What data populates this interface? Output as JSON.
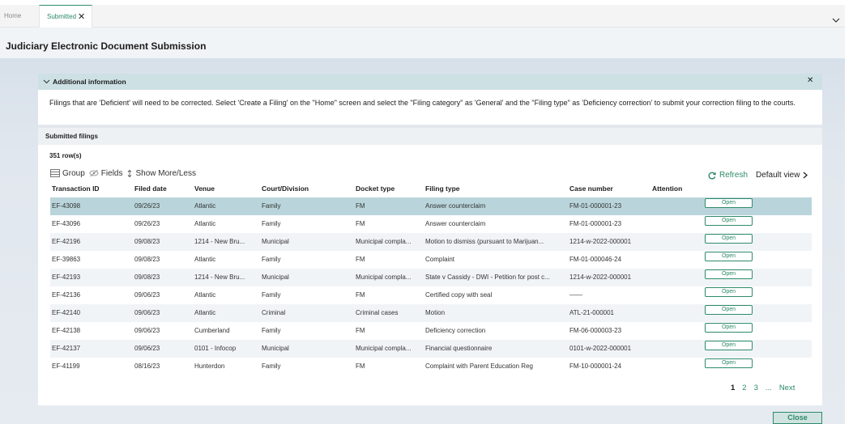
{
  "tabs": {
    "home": "Home",
    "submitted": "Submitted",
    "submitted_close": "✕"
  },
  "page_title": "Judiciary Electronic Document Submission",
  "info": {
    "title": "Additional information",
    "close": "✕",
    "text": "Filings that are 'Deficient' will need to be corrected. Select 'Create a Filing' on the \"Home\" screen and select the \"Filing category\" as 'General' and the \"Filing type\" as 'Deficiency correction' to submit your correction filing to the courts."
  },
  "submitted": {
    "title": "Submitted filings",
    "row_count": "351 row(s)",
    "toolbar": {
      "group": "Group",
      "fields": "Fields",
      "show_more": "Show More/Less"
    },
    "refresh": "Refresh",
    "default_view": "Default view",
    "columns": [
      "Transaction ID",
      "Filed date",
      "Venue",
      "Court/Division",
      "Docket type",
      "Filing type",
      "Case number",
      "Attention"
    ],
    "open_label": "Open",
    "rows": [
      {
        "id": "EF-43098",
        "date": "09/26/23",
        "venue": "Atlantic",
        "court": "Family",
        "docket": "FM",
        "filing": "Answer counterclaim",
        "case": "FM-01-000001-23",
        "attention": ""
      },
      {
        "id": "EF-43096",
        "date": "09/26/23",
        "venue": "Atlantic",
        "court": "Family",
        "docket": "FM",
        "filing": "Answer counterclaim",
        "case": "FM-01-000001-23",
        "attention": ""
      },
      {
        "id": "EF-42196",
        "date": "09/08/23",
        "venue": "1214 - New Bru...",
        "court": "Municipal",
        "docket": "Municipal compla...",
        "filing": "Motion to dismiss (pursuant to Marijuan...",
        "case": "1214-w-2022-000001",
        "attention": ""
      },
      {
        "id": "EF-39863",
        "date": "09/08/23",
        "venue": "Atlantic",
        "court": "Family",
        "docket": "FM",
        "filing": "Complaint",
        "case": "FM-01-000046-24",
        "attention": ""
      },
      {
        "id": "EF-42193",
        "date": "09/08/23",
        "venue": "1214 - New Bru...",
        "court": "Municipal",
        "docket": "Municipal compla...",
        "filing": "State v Cassidy - DWI - Petition for post c...",
        "case": "1214-w-2022-000001",
        "attention": ""
      },
      {
        "id": "EF-42136",
        "date": "09/06/23",
        "venue": "Atlantic",
        "court": "Family",
        "docket": "FM",
        "filing": "Certified copy with seal",
        "case": "——",
        "attention": ""
      },
      {
        "id": "EF-42140",
        "date": "09/06/23",
        "venue": "Atlantic",
        "court": "Criminal",
        "docket": "Criminal cases",
        "filing": "Motion",
        "case": "ATL-21-000001",
        "attention": ""
      },
      {
        "id": "EF-42138",
        "date": "09/06/23",
        "venue": "Cumberland",
        "court": "Family",
        "docket": "FM",
        "filing": "Deficiency correction",
        "case": "FM-06-000003-23",
        "attention": ""
      },
      {
        "id": "EF-42137",
        "date": "09/06/23",
        "venue": "0101 - Infocop",
        "court": "Municipal",
        "docket": "Municipal compla...",
        "filing": "Financial questionnaire",
        "case": "0101-w-2022-000001",
        "attention": ""
      },
      {
        "id": "EF-41199",
        "date": "08/16/23",
        "venue": "Hunterdon",
        "court": "Family",
        "docket": "FM",
        "filing": "Complaint with Parent Education Reg",
        "case": "FM-10-000001-24",
        "attention": ""
      }
    ],
    "pagination": {
      "pages": [
        "1",
        "2",
        "3",
        "..."
      ],
      "current": "1",
      "next": "Next"
    }
  },
  "close_button": "Close",
  "colors": {
    "accent": "#2b8a66",
    "selected_row": "#b9d5db",
    "info_header": "#cde1e5"
  },
  "icons": [
    "close-icon",
    "chevron-down-icon",
    "group-icon",
    "fields-icon",
    "show-more-less-icon",
    "refresh-icon",
    "chevron-right-icon"
  ]
}
